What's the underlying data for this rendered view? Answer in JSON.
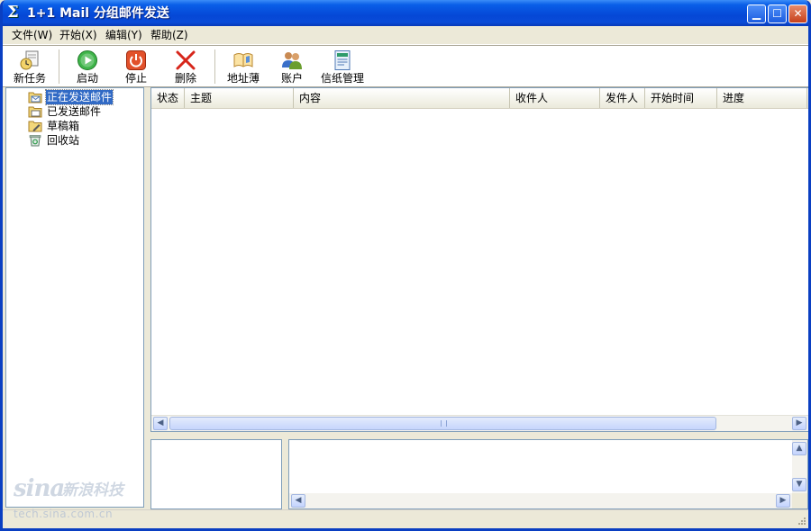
{
  "window": {
    "title": "1+1 Mail 分组邮件发送"
  },
  "menu": [
    {
      "label": "文件(W)"
    },
    {
      "label": "开始(X)"
    },
    {
      "label": "编辑(Y)"
    },
    {
      "label": "帮助(Z)"
    }
  ],
  "toolbar": {
    "new_task": "新任务",
    "start": "启动",
    "stop": "停止",
    "delete": "删除",
    "address_book": "地址薄",
    "account": "账户",
    "stationery": "信纸管理"
  },
  "tree": [
    {
      "label": "正在发送邮件",
      "selected": true
    },
    {
      "label": "已发送邮件"
    },
    {
      "label": "草稿箱"
    },
    {
      "label": "回收站"
    }
  ],
  "grid": {
    "columns": [
      "状态",
      "主题",
      "内容",
      "收件人",
      "发件人",
      "开始时间",
      "进度"
    ]
  },
  "watermark": {
    "logo": "sina",
    "cn": "新浪科技",
    "url": "tech.sina.com.cn"
  },
  "colors": {
    "title_bar": "#0A4CD8",
    "selection": "#316AC5",
    "face": "#ECE9D8"
  }
}
